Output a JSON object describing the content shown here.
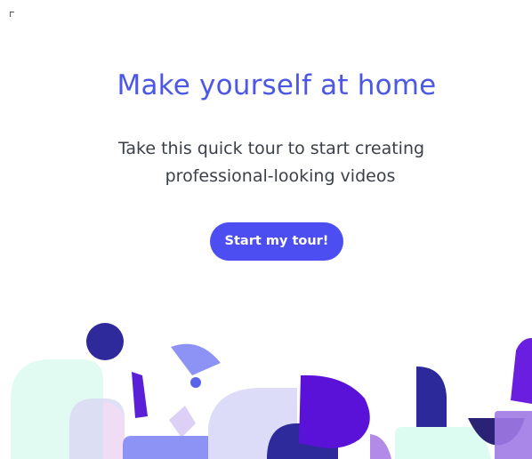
{
  "welcome": {
    "title": "Make yourself at home",
    "subtitle_line1": "Take this quick tour to start creating",
    "subtitle_line2": "professional-looking videos",
    "button_label": "Start my tour!"
  },
  "colors": {
    "accent": "#4b57e6",
    "button": "#4c4ef2",
    "text": "#3a3f4a"
  }
}
